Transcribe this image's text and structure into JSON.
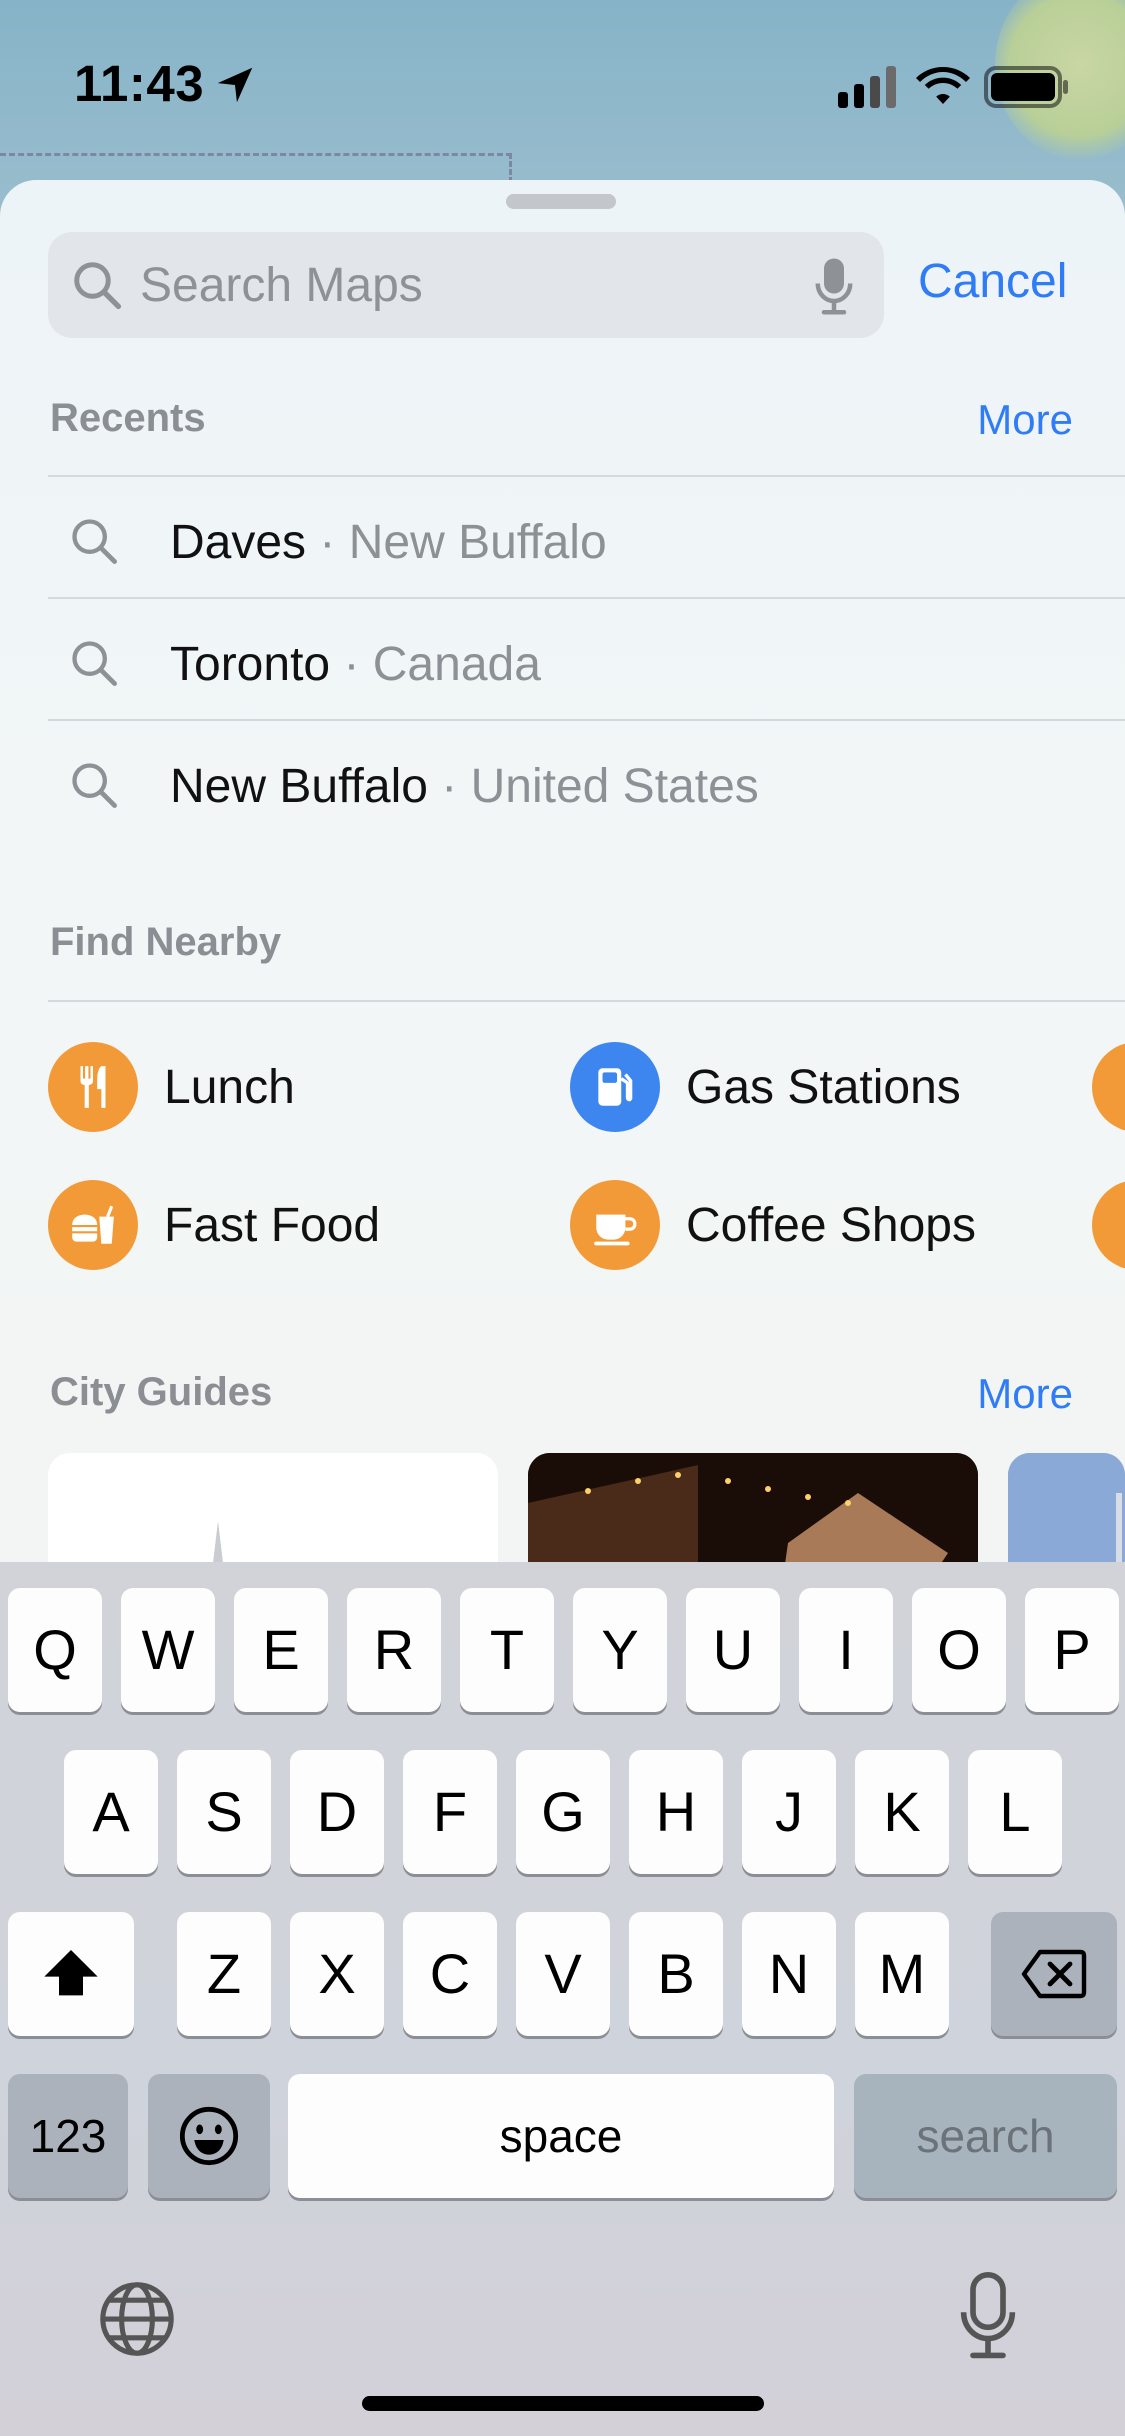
{
  "status_bar": {
    "time": "11:43"
  },
  "search": {
    "placeholder": "Search Maps",
    "cancel_label": "Cancel"
  },
  "recents": {
    "title": "Recents",
    "more_label": "More",
    "items": [
      {
        "name": "Daves",
        "sub": " · New Buffalo"
      },
      {
        "name": "Toronto",
        "sub": " · Canada"
      },
      {
        "name": "New Buffalo",
        "sub": " · United States"
      }
    ]
  },
  "find_nearby": {
    "title": "Find Nearby",
    "items": [
      {
        "label": "Lunch",
        "icon": "fork-knife-icon",
        "color": "#f39a38"
      },
      {
        "label": "Gas Stations",
        "icon": "fuel-pump-icon",
        "color": "#3d86f0"
      },
      {
        "label": "Fast Food",
        "icon": "burger-drink-icon",
        "color": "#f39a38"
      },
      {
        "label": "Coffee Shops",
        "icon": "coffee-cup-icon",
        "color": "#f39a38"
      }
    ]
  },
  "city_guides": {
    "title": "City Guides",
    "more_label": "More"
  },
  "keyboard": {
    "row1": [
      "Q",
      "W",
      "E",
      "R",
      "T",
      "Y",
      "U",
      "I",
      "O",
      "P"
    ],
    "row2": [
      "A",
      "S",
      "D",
      "F",
      "G",
      "H",
      "J",
      "K",
      "L"
    ],
    "row3": [
      "Z",
      "X",
      "C",
      "V",
      "B",
      "N",
      "M"
    ],
    "numbers_label": "123",
    "space_label": "space",
    "search_label": "search"
  },
  "colors": {
    "accent": "#2f7cf6",
    "orange": "#f39a38",
    "blue": "#3d86f0"
  }
}
